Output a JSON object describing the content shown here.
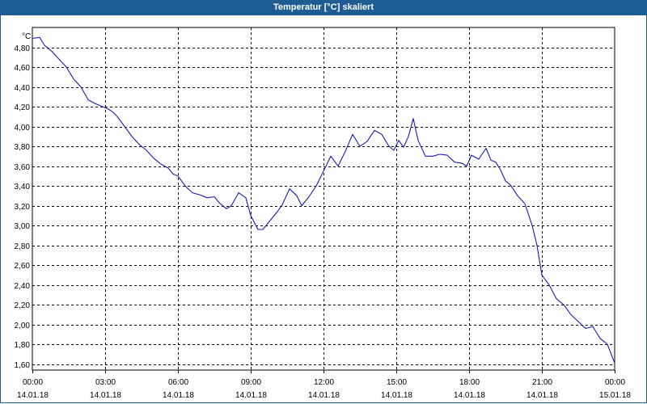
{
  "window": {
    "title": "Temperatur [°C] skaliert"
  },
  "colors": {
    "titlebar": "#1f5c93",
    "line": "#1a1ab0",
    "grid": "#000000"
  },
  "chart_data": {
    "type": "line",
    "title": "Temperatur [°C] skaliert",
    "ylabel": "°C",
    "xlabel": "",
    "ylim": [
      1.54,
      5.0
    ],
    "xlim": [
      0,
      24
    ],
    "grid": true,
    "y_ticks": [
      "4,80",
      "4,60",
      "4,40",
      "4,20",
      "4,00",
      "3,80",
      "3,60",
      "3,40",
      "3,20",
      "3,00",
      "2,80",
      "2,60",
      "2,40",
      "2,20",
      "2,00",
      "1,80",
      "1,60"
    ],
    "x_ticks": [
      {
        "time": "00:00",
        "date": "14.01.18"
      },
      {
        "time": "03:00",
        "date": "14.01.18"
      },
      {
        "time": "06:00",
        "date": "14.01.18"
      },
      {
        "time": "09:00",
        "date": "14.01.18"
      },
      {
        "time": "12:00",
        "date": "14.01.18"
      },
      {
        "time": "15:00",
        "date": "14.01.18"
      },
      {
        "time": "18:00",
        "date": "14.01.18"
      },
      {
        "time": "21:00",
        "date": "14.01.18"
      },
      {
        "time": "00:00",
        "date": "15.01.18"
      }
    ],
    "series": [
      {
        "x": [
          0,
          0.3,
          0.5,
          0.8,
          1.1,
          1.4,
          1.7,
          2.0,
          2.3,
          2.6,
          2.9,
          3.1,
          3.3,
          3.5,
          3.8,
          4.1,
          4.4,
          4.7,
          5.0,
          5.3,
          5.6,
          5.8,
          6.0,
          6.3,
          6.6,
          6.9,
          7.2,
          7.5,
          7.7,
          8.0,
          8.2,
          8.5,
          8.8,
          9.0,
          9.3,
          9.5,
          9.8,
          10.1,
          10.3,
          10.6,
          10.9,
          11.1,
          11.4,
          11.7,
          12.0,
          12.3,
          12.6,
          12.9,
          13.2,
          13.5,
          13.8,
          14.1,
          14.4,
          14.7,
          14.9,
          15.1,
          15.3,
          15.5,
          15.7,
          15.9,
          16.2,
          16.5,
          16.8,
          17.1,
          17.4,
          17.7,
          17.9,
          18.1,
          18.4,
          18.7,
          18.9,
          19.1,
          19.3,
          19.5,
          19.7,
          20.0,
          20.3,
          20.6,
          20.8,
          21.0,
          21.3,
          21.6,
          21.9,
          22.2,
          22.5,
          22.8,
          23.1,
          23.4,
          23.7,
          24.0
        ],
        "values": [
          4.89,
          4.9,
          4.82,
          4.76,
          4.68,
          4.6,
          4.48,
          4.4,
          4.27,
          4.23,
          4.2,
          4.18,
          4.15,
          4.1,
          4.0,
          3.9,
          3.82,
          3.76,
          3.68,
          3.62,
          3.58,
          3.52,
          3.5,
          3.4,
          3.33,
          3.31,
          3.28,
          3.29,
          3.23,
          3.17,
          3.2,
          3.33,
          3.28,
          3.1,
          2.96,
          2.96,
          3.05,
          3.14,
          3.21,
          3.37,
          3.3,
          3.2,
          3.29,
          3.4,
          3.55,
          3.7,
          3.6,
          3.75,
          3.92,
          3.8,
          3.85,
          3.96,
          3.92,
          3.8,
          3.76,
          3.86,
          3.79,
          3.9,
          4.08,
          3.86,
          3.7,
          3.7,
          3.72,
          3.71,
          3.64,
          3.63,
          3.6,
          3.71,
          3.67,
          3.78,
          3.66,
          3.64,
          3.56,
          3.45,
          3.41,
          3.3,
          3.22,
          3.0,
          2.8,
          2.5,
          2.4,
          2.26,
          2.2,
          2.1,
          2.03,
          1.96,
          1.98,
          1.86,
          1.8,
          1.61
        ]
      }
    ]
  }
}
